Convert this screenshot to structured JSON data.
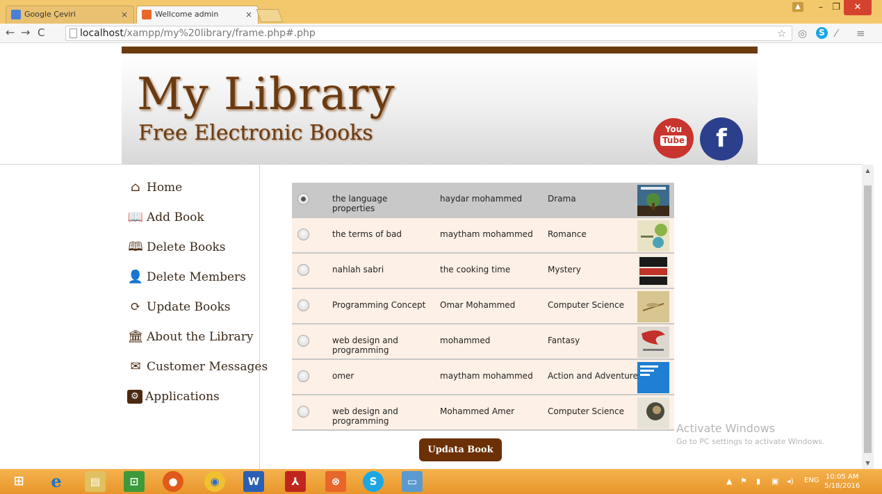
{
  "browser": {
    "tabs": [
      {
        "label": "Google Çeviri",
        "active": false
      },
      {
        "label": "Wellcome admin",
        "active": true
      }
    ],
    "close_glyph": "×",
    "url_host": "localhost",
    "url_path": "/xampp/my%20library/frame.php#.php"
  },
  "header": {
    "title": "My Library",
    "subtitle": "Free Electronic Books",
    "youtube_you": "You",
    "youtube_tube": "Tube",
    "facebook": "f"
  },
  "sidebar": {
    "items": [
      {
        "label": "Home",
        "icon": "home-icon"
      },
      {
        "label": "Add Book",
        "icon": "book-open-icon"
      },
      {
        "label": "Delete Books",
        "icon": "book-delete-icon"
      },
      {
        "label": "Delete Members",
        "icon": "user-delete-icon"
      },
      {
        "label": "Update Books",
        "icon": "refresh-icon"
      },
      {
        "label": "About the Library",
        "icon": "institution-icon"
      },
      {
        "label": "Customer Messages",
        "icon": "envelope-icon"
      },
      {
        "label": "Applications",
        "icon": "gear-icon"
      }
    ]
  },
  "books": {
    "rows": [
      {
        "title": "the language properties",
        "author": "haydar mohammed",
        "genre": "Drama",
        "selected": true
      },
      {
        "title": "the terms of bad",
        "author": "maytham mohammed",
        "genre": "Romance",
        "selected": false
      },
      {
        "title": "nahlah sabri",
        "author": "the cooking time",
        "genre": "Mystery",
        "selected": false
      },
      {
        "title": "Programming Concept",
        "author": "Omar Mohammed",
        "genre": "Computer Science",
        "selected": false
      },
      {
        "title": "web design and programming",
        "author": "mohammed",
        "genre": "Fantasy",
        "selected": false
      },
      {
        "title": "omer",
        "author": "maytham mohammed",
        "genre": "Action and Adventure",
        "selected": false
      },
      {
        "title": "web design and programming",
        "author": "Mohammed Amer",
        "genre": "Computer Science",
        "selected": false
      }
    ],
    "update_button": "Updata Book"
  },
  "watermark": {
    "line1": "Activate Windows",
    "line2": "Go to PC settings to activate Windows."
  },
  "taskbar": {
    "lang": "ENG",
    "time": "10:05 AM",
    "date": "5/18/2016"
  },
  "colors": {
    "brand_brown": "#6b3a10",
    "row_bg": "#fdf0e6",
    "row_selected": "#c8c8c8",
    "taskbar": "#f0a540"
  }
}
